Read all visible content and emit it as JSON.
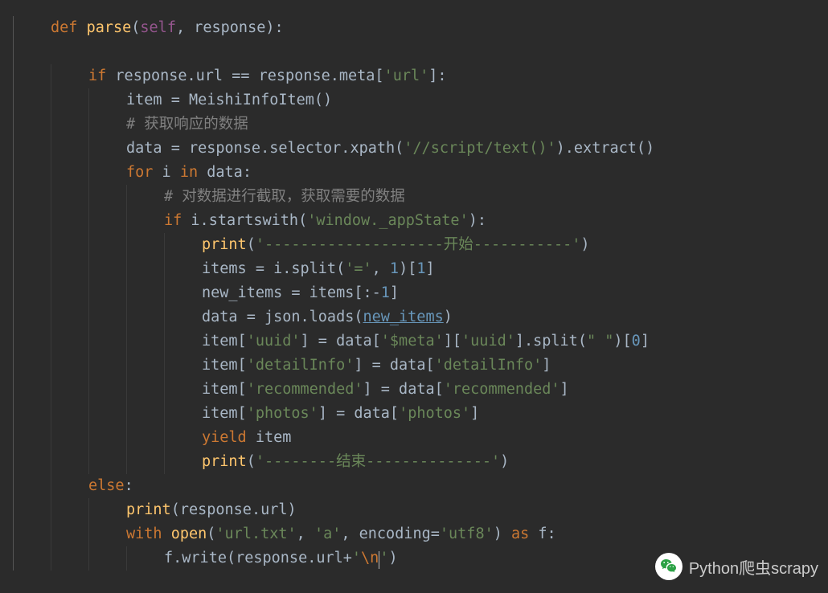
{
  "code": {
    "l1": {
      "kw_def": "def ",
      "fn": "parse",
      "lp": "(",
      "self": "self",
      "sep": ", response):",
      "rest": ""
    },
    "l2": {
      "kw_if": "if",
      "cond": " response.url == response.meta[",
      "str": "'url'",
      "tail": "]:"
    },
    "l3": {
      "lhs": "item = MeishiInfoItem()"
    },
    "l4": {
      "cmt": "# 获取响应的数据"
    },
    "l5": {
      "lhs": "data = response.selector.xpath(",
      "str": "'//script/text()'",
      "tail": ").extract()"
    },
    "l6": {
      "kw_for": "for",
      "mid": " i ",
      "kw_in": "in",
      "tail": " data:"
    },
    "l7": {
      "cmt": "# 对数据进行截取，获取需要的数据"
    },
    "l8": {
      "kw_if": "if",
      "lhs": " i.startswith(",
      "str": "'window._appState'",
      "tail": "):"
    },
    "l9": {
      "fn": "print",
      "lp": "(",
      "str": "'--------------------开始-----------'",
      "rp": ")"
    },
    "l10": {
      "lhs": "items = i.split(",
      "str1": "'='",
      "sep": ", ",
      "num": "1",
      "tail1": ")[",
      "idx": "1",
      "tail2": "]"
    },
    "l11": {
      "lhs": "new_items = items[:-",
      "num": "1",
      "tail": "]"
    },
    "l12": {
      "lhs": "data = json.loads(",
      "arg": "new_items",
      "tail": ")"
    },
    "l13": {
      "lhs": "item[",
      "k1": "'uuid'",
      "mid": "] = data[",
      "k2": "'$meta'",
      "mid2": "][",
      "k3": "'uuid'",
      "tail": "].split(",
      "sp": "\" \"",
      "tail2": ")[",
      "idx": "0",
      "tail3": "]"
    },
    "l14": {
      "lhs": "item[",
      "k1": "'detailInfo'",
      "mid": "] = data[",
      "k2": "'detailInfo'",
      "tail": "]"
    },
    "l15": {
      "lhs": "item[",
      "k1": "'recommended'",
      "mid": "] = data[",
      "k2": "'recommended'",
      "tail": "]"
    },
    "l16": {
      "lhs": "item[",
      "k1": "'photos'",
      "mid": "] = data[",
      "k2": "'photos'",
      "tail": "]"
    },
    "l17": {
      "kw_yield": "yield",
      "tail": " item"
    },
    "l18": {
      "fn": "print",
      "lp": "(",
      "str": "'--------结束--------------'",
      "rp": ")"
    },
    "l19": {
      "kw_else": "else",
      "tail": ":"
    },
    "l20": {
      "fn": "print",
      "lp": "(",
      "arg": "response.url",
      "rp": ")"
    },
    "l21": {
      "kw_with": "with",
      "sp": " ",
      "fn": "open",
      "lp": "(",
      "s1": "'url.txt'",
      "c1": ", ",
      "s2": "'a'",
      "c2": ", ",
      "kw_enc": "encoding",
      "eq": "=",
      "s3": "'utf8'",
      "rp": ") ",
      "kw_as": "as",
      "tail": " f:"
    },
    "l22": {
      "lhs": "f.write(response.url+",
      "q1": "'",
      "esc": "\\n",
      "q2": "'",
      "rp": ")"
    }
  },
  "watermark": {
    "text": "Python爬虫scrapy"
  }
}
